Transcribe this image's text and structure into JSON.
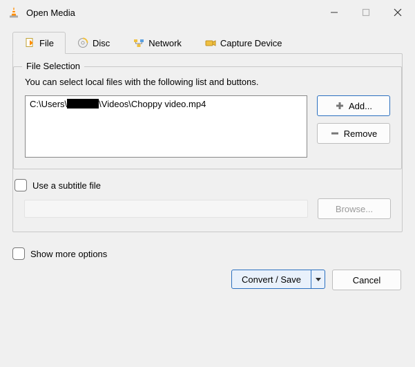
{
  "window": {
    "title": "Open Media"
  },
  "tabs": {
    "file": "File",
    "disc": "Disc",
    "network": "Network",
    "capture": "Capture Device"
  },
  "fileSelection": {
    "legend": "File Selection",
    "hint": "You can select local files with the following list and buttons.",
    "items": {
      "prefix": "C:\\Users\\",
      "suffix": "\\Videos\\Choppy video.mp4"
    },
    "addLabel": "Add...",
    "removeLabel": "Remove"
  },
  "subtitle": {
    "checkboxLabel": "Use a subtitle file",
    "browseLabel": "Browse..."
  },
  "footer": {
    "showMore": "Show more options",
    "convertSave": "Convert / Save",
    "cancel": "Cancel"
  }
}
